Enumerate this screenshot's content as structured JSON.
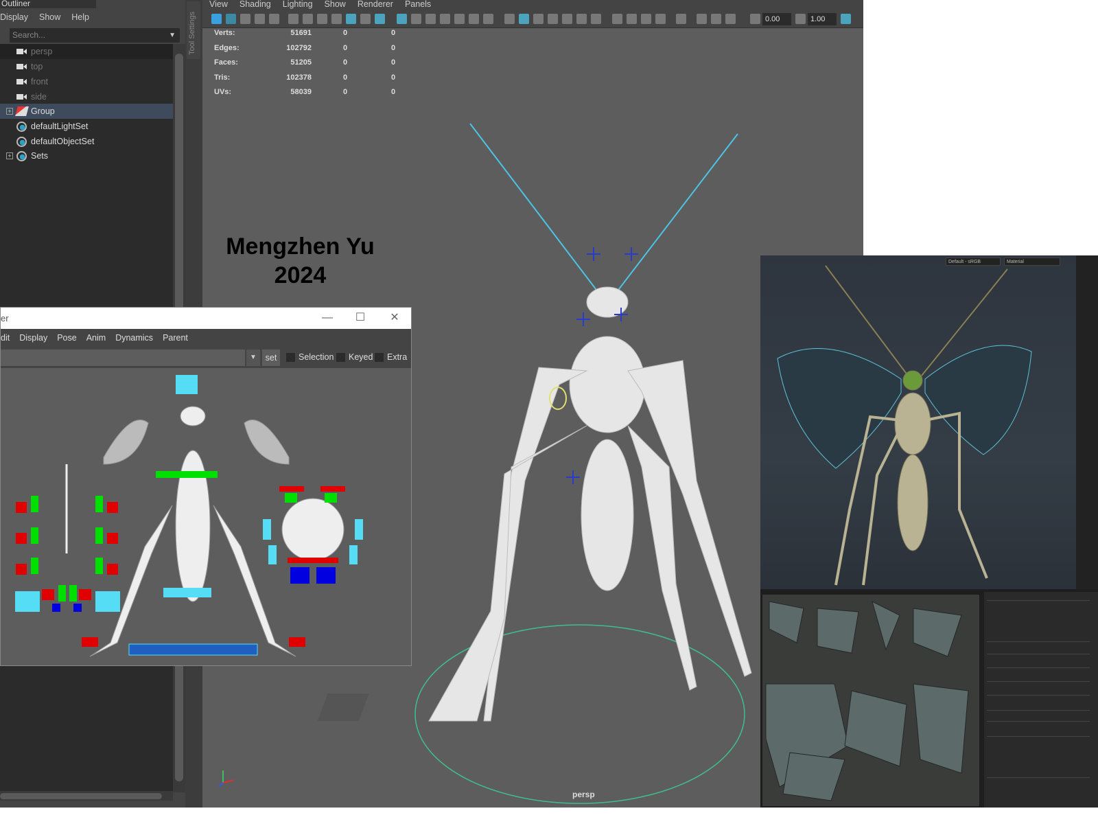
{
  "outliner": {
    "title": "Outliner",
    "menu": [
      "Display",
      "Show",
      "Help"
    ],
    "search_placeholder": "Search...",
    "items": [
      {
        "label": "persp",
        "icon": "camera-icon",
        "dim": true
      },
      {
        "label": "top",
        "icon": "camera-icon",
        "dim": true
      },
      {
        "label": "front",
        "icon": "camera-icon",
        "dim": true
      },
      {
        "label": "side",
        "icon": "camera-icon",
        "dim": true
      },
      {
        "label": "Group",
        "icon": "group-icon",
        "selected": true,
        "expandable": true
      },
      {
        "label": "defaultLightSet",
        "icon": "set-icon"
      },
      {
        "label": "defaultObjectSet",
        "icon": "set-icon"
      },
      {
        "label": "Sets",
        "icon": "set-icon",
        "expandable": true
      }
    ]
  },
  "tool_settings": {
    "label": "Tool Settings"
  },
  "viewport": {
    "menu": [
      "View",
      "Shading",
      "Lighting",
      "Show",
      "Renderer",
      "Panels"
    ],
    "toolbar": {
      "exposure": "0.00",
      "gamma": "1.00"
    },
    "stats": [
      {
        "label": "Verts:",
        "values": [
          "51691",
          "0",
          "0"
        ]
      },
      {
        "label": "Edges:",
        "values": [
          "102792",
          "0",
          "0"
        ]
      },
      {
        "label": "Faces:",
        "values": [
          "51205",
          "0",
          "0"
        ]
      },
      {
        "label": "Tris:",
        "values": [
          "102378",
          "0",
          "0"
        ]
      },
      {
        "label": "UVs:",
        "values": [
          "58039",
          "0",
          "0"
        ]
      }
    ],
    "camera_label": "persp"
  },
  "credit": {
    "name": "Mengzhen Yu",
    "year": "2024"
  },
  "picker": {
    "title": "er",
    "menu": [
      "dit",
      "Display",
      "Pose",
      "Anim",
      "Dynamics",
      "Parent"
    ],
    "set_button": "set",
    "checkboxes": [
      "Selection",
      "Keyed",
      "Extra"
    ]
  },
  "render_view": {
    "color_space": "Default - sRGB",
    "mode": "Material"
  },
  "colors": {
    "maya_accent": "#4dc3e6",
    "control_red": "#ff0000",
    "control_green": "#00e000",
    "control_blue": "#0000ff",
    "control_cyan": "#55ddf5"
  }
}
